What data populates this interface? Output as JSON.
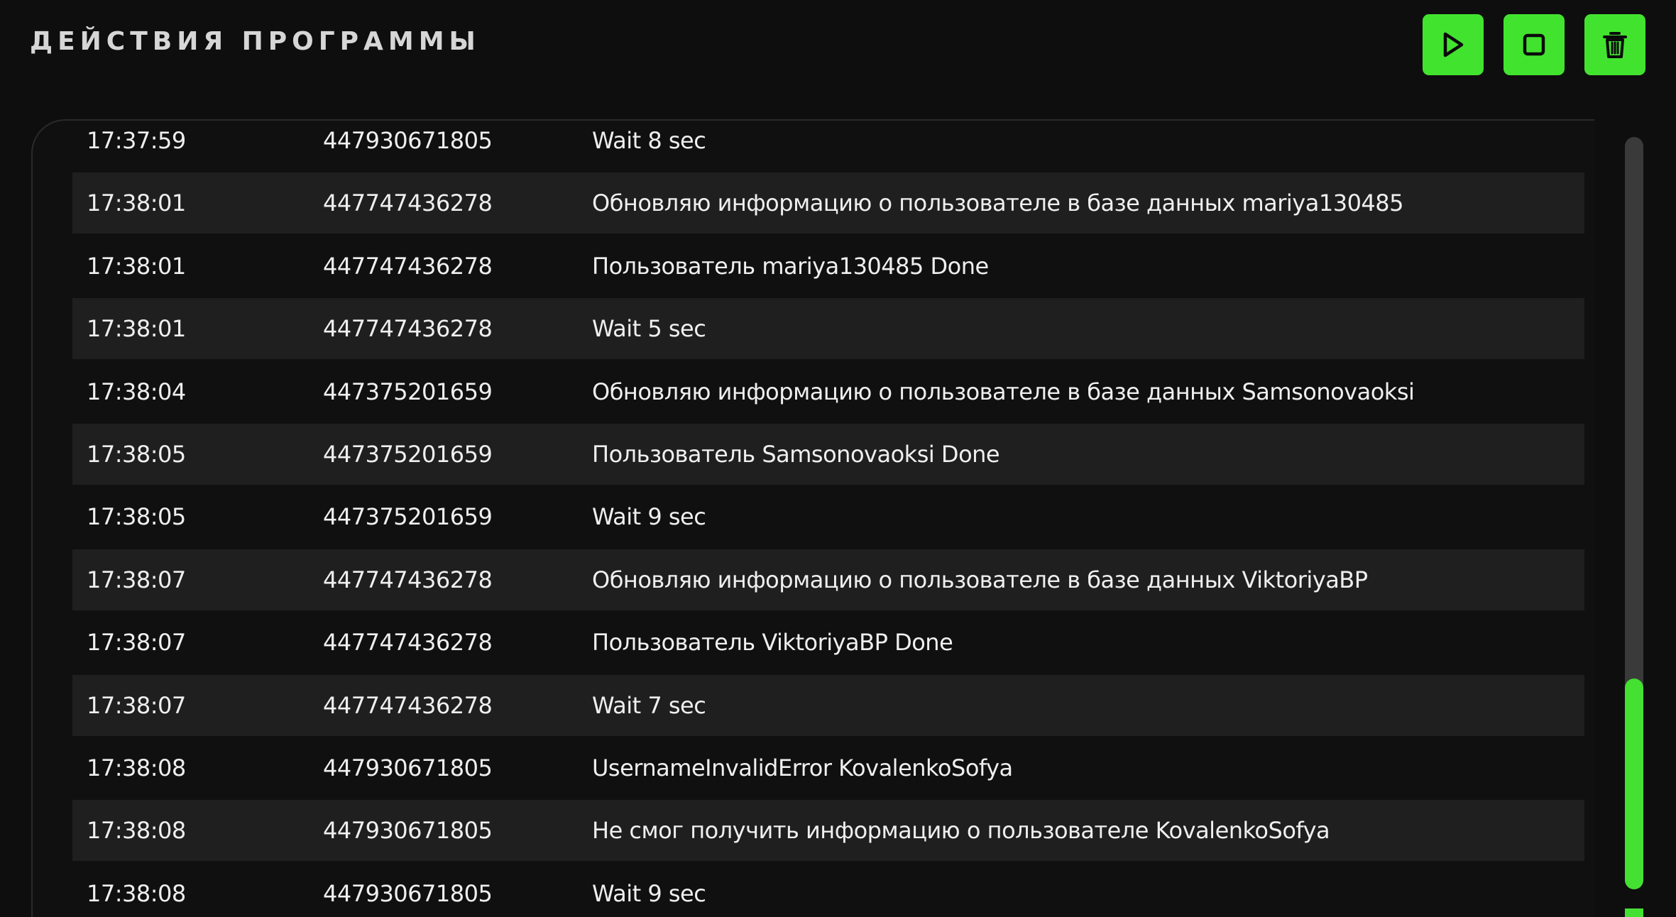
{
  "header": {
    "title": "ДЕЙСТВИЯ ПРОГРАММЫ"
  },
  "toolbar": {
    "buttons": [
      {
        "icon": "play-icon"
      },
      {
        "icon": "stop-icon"
      },
      {
        "icon": "trash-icon"
      }
    ],
    "accent_color": "#42e32f",
    "icon_color": "#0a0a0a"
  },
  "log": {
    "rows": [
      {
        "time": "17:37:59",
        "id": "447930671805",
        "message": "Wait 8 sec"
      },
      {
        "time": "17:38:01",
        "id": "447747436278",
        "message": "Обновляю информацию о пользователе в базе данных mariya130485"
      },
      {
        "time": "17:38:01",
        "id": "447747436278",
        "message": "Пользователь mariya130485 Done"
      },
      {
        "time": "17:38:01",
        "id": "447747436278",
        "message": "Wait 5 sec"
      },
      {
        "time": "17:38:04",
        "id": "447375201659",
        "message": "Обновляю информацию о пользователе в базе данных Samsonovaoksi"
      },
      {
        "time": "17:38:05",
        "id": "447375201659",
        "message": "Пользователь Samsonovaoksi Done"
      },
      {
        "time": "17:38:05",
        "id": "447375201659",
        "message": "Wait 9 sec"
      },
      {
        "time": "17:38:07",
        "id": "447747436278",
        "message": "Обновляю информацию о пользователе в базе данных ViktoriyaBP"
      },
      {
        "time": "17:38:07",
        "id": "447747436278",
        "message": "Пользователь ViktoriyaBP Done"
      },
      {
        "time": "17:38:07",
        "id": "447747436278",
        "message": "Wait 7 sec"
      },
      {
        "time": "17:38:08",
        "id": "447930671805",
        "message": "UsernameInvalidError KovalenkoSofya"
      },
      {
        "time": "17:38:08",
        "id": "447930671805",
        "message": "Не смог получить информацию о пользователе KovalenkoSofya"
      },
      {
        "time": "17:38:08",
        "id": "447930671805",
        "message": "Wait 9 sec"
      }
    ]
  },
  "scrollbar": {
    "thumb_color": "#44e032",
    "track_color": "#3a3a3a"
  }
}
